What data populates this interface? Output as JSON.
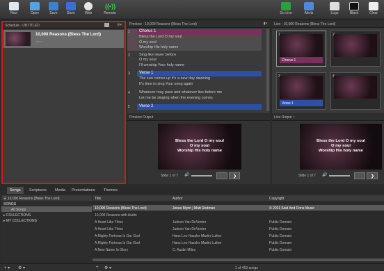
{
  "toolbar": {
    "new": "New",
    "open": "Open",
    "save": "Save",
    "store": "Store",
    "web": "Web",
    "remote": "Remote",
    "go_live": "Go Live",
    "alerts": "Alerts",
    "logo": "Logo",
    "black": "Black",
    "clear": "Clear"
  },
  "schedule": {
    "header": "Schedule - UNTITLED",
    "item_title": "10,000 Reasons (Bless The Lord)",
    "item_sub": "audio"
  },
  "preview": {
    "header": "Preview - 10,000 Reasons (Bless The Lord)",
    "slides": [
      {
        "num": "1",
        "head": "Chorus 1",
        "lines": [
          "Bless the Lord O my soul",
          "O my soul",
          "Worship His holy name"
        ]
      },
      {
        "num": "2",
        "head": "",
        "lines": [
          "Sing like never before",
          "O my soul",
          "I'll worship Your holy name"
        ]
      },
      {
        "num": "3",
        "head": "Verse 1",
        "lines": [
          "The sun comes up it's a new day dawning",
          "It's time to sing Your song again"
        ]
      },
      {
        "num": "4",
        "head": "",
        "lines": [
          "Whatever may pass and whatever lies before me",
          "Let me be singing when the evening comes"
        ]
      },
      {
        "num": "5",
        "head": "Verse 2",
        "lines": []
      }
    ]
  },
  "live": {
    "header": "Live - 10,000 Reasons (Bless The Lord)",
    "cards": [
      {
        "num": "1",
        "label": "Chorus 1"
      },
      {
        "num": "2",
        "label": ""
      },
      {
        "num": "3",
        "label": "Verse 1"
      },
      {
        "num": "4",
        "label": ""
      }
    ]
  },
  "preview_output": {
    "header": "Preview Output",
    "lines": [
      "Bless the Lord O my soul",
      "O my soul",
      "Worship His holy name"
    ],
    "slide_of": "Slide 1 of 7"
  },
  "live_output": {
    "header": "Live Output ~",
    "lines": [
      "Bless the Lord O my soul",
      "O my soul",
      "Worship His holy name"
    ],
    "slide_of": "Slide 1 of 7"
  },
  "library": {
    "tabs": [
      "Songs",
      "Scriptures",
      "Media",
      "Presentations",
      "Themes"
    ],
    "left_header": "10,000 Reasons (Bless The Lord)",
    "songs_label": "SONGS",
    "all_songs": "All Songs",
    "collections": "COLLECTIONS",
    "my_collections": "MY COLLECTIONS",
    "columns": [
      "Title",
      "Author",
      "Copyright"
    ],
    "rows": [
      [
        "10,000 Reasons (Bless The Lord)",
        "Jonas Myrin | Matt Redman",
        "© 2011 Said And Done Music"
      ],
      [
        "10,000 Reasons with Audio",
        "",
        ""
      ],
      [
        "A Heart Like Thine",
        "Judson Van DeVenter",
        "Public Domain"
      ],
      [
        "A Heart Like Thine",
        "Judson Van DeVenter",
        "Public Domain"
      ],
      [
        "A Mighty Fortress Is Our God",
        "Hans Leo Hassler Martin Luther",
        "Public Domain"
      ],
      [
        "A Mighty Fortress Is Our God",
        "Hans Leo Hassler Martin Luther",
        "Public Domain"
      ],
      [
        "A New Name In Glory",
        "C. Austin Miles",
        "Public Domain"
      ]
    ],
    "status": "1 of 419 songs"
  }
}
